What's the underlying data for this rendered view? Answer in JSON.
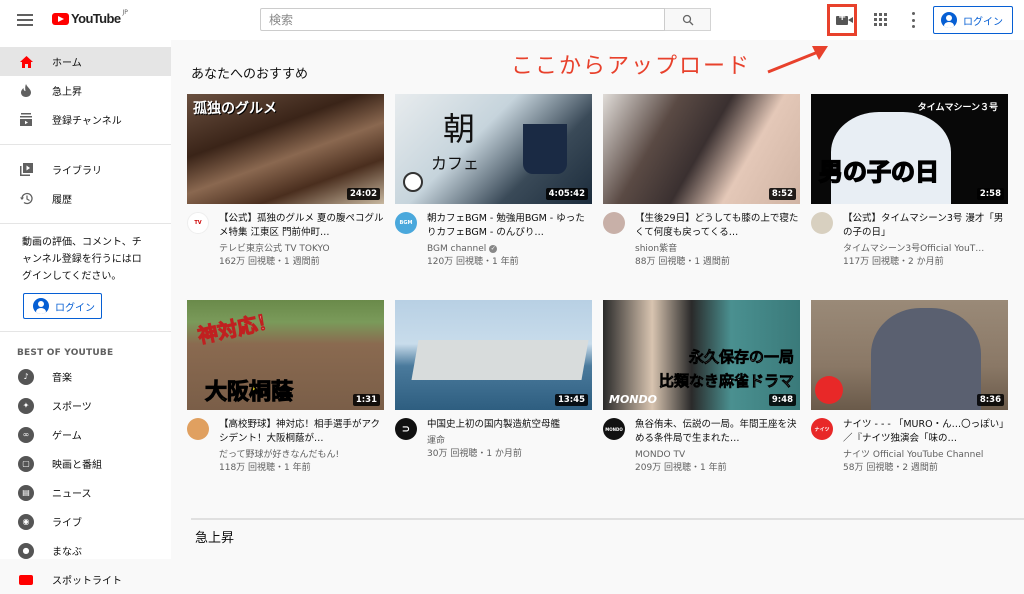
{
  "header": {
    "logo_text": "YouTube",
    "logo_region": "JP",
    "search_placeholder": "検索",
    "login_label": "ログイン",
    "icons": {
      "menu": "hamburger-menu-icon",
      "search": "search-icon",
      "upload": "video-camera-plus-icon",
      "apps": "apps-grid-icon",
      "more": "more-vert-icon",
      "account": "account-circle-icon"
    }
  },
  "annotation": {
    "text": "ここからアップロード",
    "color": "#e8412c"
  },
  "sidebar": {
    "primary": [
      {
        "label": "ホーム",
        "icon": "home-icon",
        "active": true
      },
      {
        "label": "急上昇",
        "icon": "trending-flame-icon",
        "active": false
      },
      {
        "label": "登録チャンネル",
        "icon": "subscriptions-icon",
        "active": false
      }
    ],
    "secondary": [
      {
        "label": "ライブラリ",
        "icon": "library-icon"
      },
      {
        "label": "履歴",
        "icon": "history-icon"
      }
    ],
    "signin_message": "動画の評価、コメント、チャンネル登録を行うにはログインしてください。",
    "login_label": "ログイン",
    "best_heading": "BEST OF YOUTUBE",
    "best": [
      {
        "label": "音楽",
        "icon": "music-icon"
      },
      {
        "label": "スポーツ",
        "icon": "sports-icon"
      },
      {
        "label": "ゲーム",
        "icon": "gaming-icon"
      },
      {
        "label": "映画と番組",
        "icon": "movies-icon"
      },
      {
        "label": "ニュース",
        "icon": "news-icon"
      },
      {
        "label": "ライブ",
        "icon": "live-icon"
      },
      {
        "label": "まなぶ",
        "icon": "learning-icon"
      },
      {
        "label": "スポットライト",
        "icon": "spotlight-icon"
      }
    ]
  },
  "main": {
    "shelf_title": "あなたへのおすすめ",
    "next_shelf_title": "急上昇",
    "videos": [
      {
        "title": "【公式】孤独のグルメ 夏の腹ペコグルメ特集 江東区 門前仲町…",
        "channel": "テレビ東京公式 TV TOKYO",
        "stats": "162万 回視聴・1 週間前",
        "duration": "24:02",
        "thumb_text": "孤独のグルメ",
        "verified": false
      },
      {
        "title": "朝カフェBGM - 勉強用BGM - ゆったりカフェBGM - のんびり…",
        "channel": "BGM channel",
        "stats": "120万 回視聴・1 年前",
        "duration": "4:05:42",
        "thumb_text": "朝",
        "thumb_text2": "カフェ",
        "verified": true
      },
      {
        "title": "【生後29日】どうしても膝の上で寝たくて何度も戻ってくる…",
        "channel": "shion紫音",
        "stats": "88万 回視聴・1 週間前",
        "duration": "8:52",
        "verified": false
      },
      {
        "title": "【公式】タイムマシーン3号 漫才「男の子の日」",
        "channel": "タイムマシーン3号Official YouT…",
        "stats": "117万 回視聴・2 か月前",
        "duration": "2:58",
        "thumb_text": "男の子の日",
        "thumb_text2": "タイムマシーン３号",
        "verified": false
      },
      {
        "title": "【高校野球】神対応！相手選手がアクシデント！大阪桐蔭が…",
        "channel": "だって野球が好きなんだもん!",
        "stats": "118万 回視聴・1 年前",
        "duration": "1:31",
        "thumb_text": "神対応！",
        "thumb_text2": "大阪桐蔭",
        "verified": false
      },
      {
        "title": "中国史上初の国内製造航空母艦",
        "channel": "運命",
        "stats": "30万 回視聴・1 か月前",
        "duration": "13:45",
        "verified": false
      },
      {
        "title": "魚谷侑未、伝説の一局。年間王座を決める条件局で生まれた…",
        "channel": "MONDO TV",
        "stats": "209万 回視聴・1 年前",
        "duration": "9:48",
        "thumb_text": "永久保存の一局",
        "thumb_text2": "比類なき麻雀ドラマ",
        "verified": false
      },
      {
        "title": "ナイツ - - - 「MURO・ん…〇っぽい」／『ナイツ独演会「味の…",
        "channel": "ナイツ Official YouTube Channel",
        "stats": "58万 回視聴・2 週間前",
        "duration": "8:36",
        "verified": false
      }
    ]
  }
}
